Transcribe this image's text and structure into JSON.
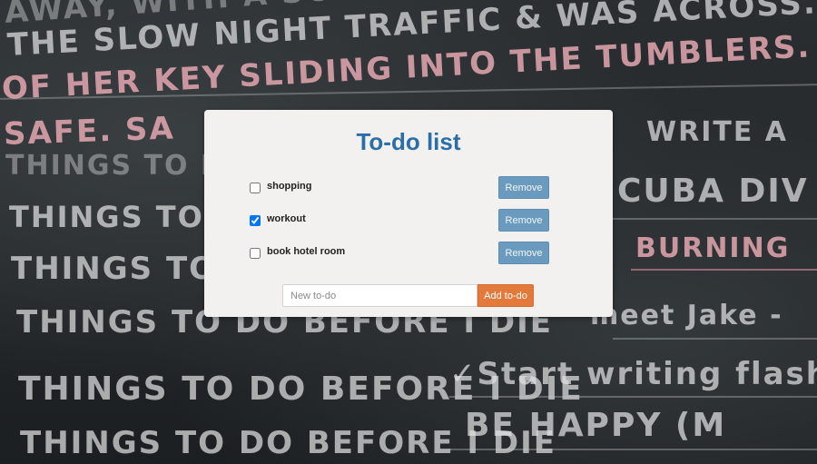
{
  "background": {
    "chalk_lines": [
      "AWAY, WITH A SCOTCH",
      "THE SLOW NIGHT TRAFFIC & WAS ACROSS. THE C",
      "OF HER KEY SLIDING INTO THE TUMBLERS. SH",
      "SAFE. SA",
      "THINGS TO DO",
      "THINGS TO D",
      "THINGS TO D",
      "THINGS TO DO BEFORE I DIE",
      "THINGS TO DO BEFORE I DIE",
      "THINGS TO DO BEFORE I DIE",
      "WRITE A",
      "CUBA DIV",
      "BURNING",
      "meet Jake -",
      "✓Start writing flash f",
      "BE HAPPY (M"
    ]
  },
  "app": {
    "title": "To-do list",
    "todos": [
      {
        "label": "shopping",
        "checked": false,
        "remove_label": "Remove"
      },
      {
        "label": "workout",
        "checked": true,
        "remove_label": "Remove"
      },
      {
        "label": "book hotel room",
        "checked": false,
        "remove_label": "Remove"
      }
    ],
    "new_todo": {
      "value": "",
      "placeholder": "New to-do"
    },
    "add_label": "Add to-do"
  },
  "colors": {
    "title": "#2b6fa6",
    "remove_button": "#6a9bbf",
    "add_button": "#e37a3b",
    "card": "#f3f1f0"
  }
}
